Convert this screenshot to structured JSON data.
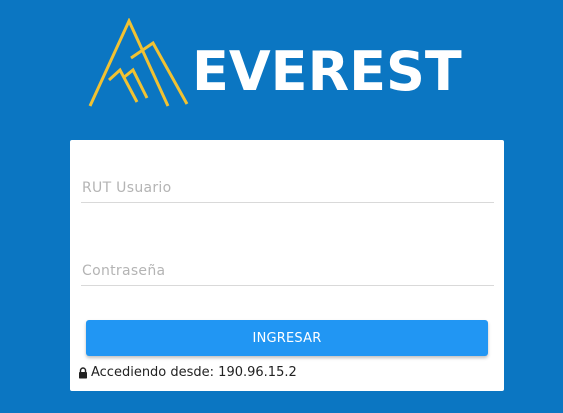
{
  "brand": {
    "name": "EVEREST",
    "logo_icon": "mountains-icon",
    "logo_color": "#f1c232"
  },
  "colors": {
    "background": "#0b76c2",
    "card": "#ffffff",
    "button": "#2196f3",
    "button_text": "#ffffff"
  },
  "login": {
    "username": {
      "placeholder": "RUT Usuario",
      "value": ""
    },
    "password": {
      "placeholder": "Contraseña",
      "value": ""
    },
    "submit_label": "INGRESAR"
  },
  "access_info": {
    "icon": "lock-icon",
    "label": "Accediendo desde: 190.96.15.2"
  }
}
